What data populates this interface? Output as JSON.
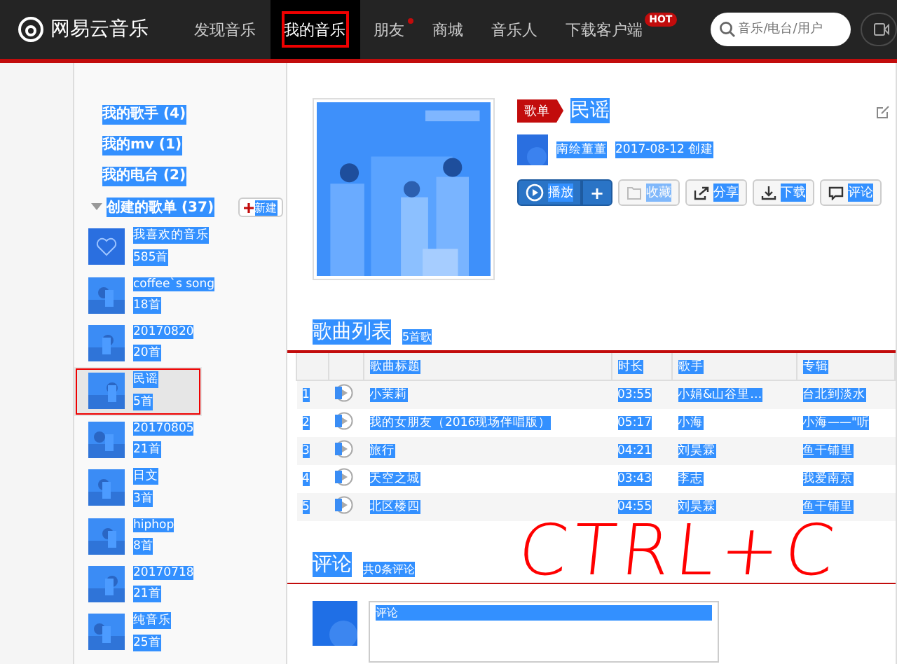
{
  "header": {
    "logo": "网易云音乐",
    "nav": [
      {
        "label": "发现音乐",
        "selected": false
      },
      {
        "label": "我的音乐",
        "selected": true
      },
      {
        "label": "朋友",
        "selected": false,
        "dot": true
      },
      {
        "label": "商城",
        "selected": false
      },
      {
        "label": "音乐人",
        "selected": false
      },
      {
        "label": "下载客户端",
        "selected": false,
        "badge": "HOT"
      }
    ],
    "search": {
      "placeholder": "音乐/电台/用户"
    }
  },
  "sidebar": {
    "links": [
      "我的歌手 (4)",
      "我的mv (1)",
      "我的电台 (2)"
    ],
    "section": {
      "title": "创建的歌单 (37)",
      "expanded": true,
      "new_button": "新建"
    },
    "playlists": [
      {
        "name": "我喜欢的音乐",
        "count": "585首",
        "kind": "liked",
        "selected": false
      },
      {
        "name": "coffee`s song",
        "count": "18首",
        "kind": "cover",
        "selected": false
      },
      {
        "name": "20170820",
        "count": "20首",
        "kind": "cover",
        "selected": false
      },
      {
        "name": "民谣",
        "count": "5首",
        "kind": "cover",
        "selected": true
      },
      {
        "name": "20170805",
        "count": "21首",
        "kind": "cover",
        "selected": false
      },
      {
        "name": "日文",
        "count": "3首",
        "kind": "cover",
        "selected": false
      },
      {
        "name": "hiphop",
        "count": "8首",
        "kind": "cover",
        "selected": false
      },
      {
        "name": "20170718",
        "count": "21首",
        "kind": "cover",
        "selected": false
      },
      {
        "name": "纯音乐",
        "count": "25首",
        "kind": "cover",
        "selected": false
      }
    ]
  },
  "playlist": {
    "tag": "歌单",
    "title": "民谣",
    "creator": "南绘董董",
    "created": "2017-08-12 创建",
    "buttons": [
      {
        "kind": "play",
        "label": "播放"
      },
      {
        "kind": "add",
        "label": "+"
      },
      {
        "kind": "collect",
        "label": "收藏"
      },
      {
        "kind": "share",
        "label": "分享"
      },
      {
        "kind": "download",
        "label": "下载"
      },
      {
        "kind": "comment",
        "label": "评论"
      }
    ]
  },
  "songs": {
    "title": "歌曲列表",
    "count": "5首歌",
    "columns": [
      "歌曲标题",
      "时长",
      "歌手",
      "专辑"
    ],
    "rows": [
      {
        "index": "1",
        "title": "小茉莉",
        "duration": "03:55",
        "artist": "小娟&山谷里…",
        "album": "台北到淡水"
      },
      {
        "index": "2",
        "title": "我的女朋友（2016现场伴唱版）",
        "duration": "05:17",
        "artist": "小海",
        "album": "小海——\"听"
      },
      {
        "index": "3",
        "title": "旅行",
        "duration": "04:21",
        "artist": "刘昊霖",
        "album": "鱼干铺里"
      },
      {
        "index": "4",
        "title": "天空之城",
        "duration": "03:43",
        "artist": "李志",
        "album": "我爱南京"
      },
      {
        "index": "5",
        "title": "北区楼四",
        "duration": "04:55",
        "artist": "刘昊霖",
        "album": "鱼干铺里"
      }
    ]
  },
  "comments": {
    "title": "评论",
    "count": "共0条评论",
    "placeholder": "评论"
  },
  "annotation": "CTRL+C"
}
